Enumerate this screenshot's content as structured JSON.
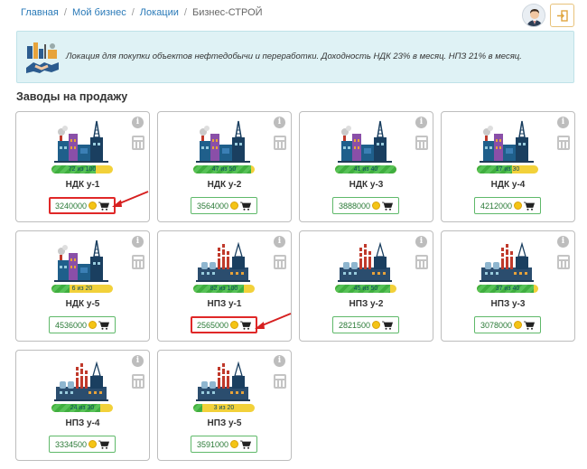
{
  "breadcrumb": {
    "home": "Главная",
    "business": "Мой бизнес",
    "locations": "Локации",
    "current": "Бизнес-СТРОЙ"
  },
  "banner": {
    "text": "Локация для покупки объектов нефтедобычи и переработки. Доходность НДК 23% в месяц. НПЗ 21% в месяц."
  },
  "section_title": "Заводы на продажу",
  "accent": {
    "bar_green": "#3fae3f",
    "bar_yellow": "#f2d13a",
    "button_border": "#5fb96a",
    "highlight_red": "#e02828"
  },
  "icons": {
    "info": "i",
    "calculator": "calculator-icon",
    "cart": "cart-icon",
    "coin": "coin-icon",
    "logout": "logout-icon",
    "avatar": "user-avatar"
  },
  "cards": [
    {
      "name": "НДК у-1",
      "progress": "72 из 100",
      "fill": 0.72,
      "price": "3240000",
      "kind": "ndk",
      "highlight": true
    },
    {
      "name": "НДК у-2",
      "progress": "47 из 50",
      "fill": 0.94,
      "price": "3564000",
      "kind": "ndk",
      "highlight": false
    },
    {
      "name": "НДК у-3",
      "progress": "41 из 40",
      "fill": 1.0,
      "price": "3888000",
      "kind": "ndk",
      "highlight": false
    },
    {
      "name": "НДК у-4",
      "progress": "17 из 30",
      "fill": 0.57,
      "price": "4212000",
      "kind": "ndk",
      "highlight": false
    },
    {
      "name": "НДК у-5",
      "progress": "6 из 20",
      "fill": 0.3,
      "price": "4536000",
      "kind": "ndk",
      "highlight": false
    },
    {
      "name": "НПЗ у-1",
      "progress": "82 из 100",
      "fill": 0.82,
      "price": "2565000",
      "kind": "npz",
      "highlight": true
    },
    {
      "name": "НПЗ у-2",
      "progress": "45 из 50",
      "fill": 0.9,
      "price": "2821500",
      "kind": "npz",
      "highlight": false
    },
    {
      "name": "НПЗ у-3",
      "progress": "37 из 40",
      "fill": 0.93,
      "price": "3078000",
      "kind": "npz",
      "highlight": false
    },
    {
      "name": "НПЗ у-4",
      "progress": "24 из 30",
      "fill": 0.8,
      "price": "3334500",
      "kind": "npz",
      "highlight": false
    },
    {
      "name": "НПЗ у-5",
      "progress": "3 из 20",
      "fill": 0.15,
      "price": "3591000",
      "kind": "npz",
      "highlight": false
    }
  ]
}
